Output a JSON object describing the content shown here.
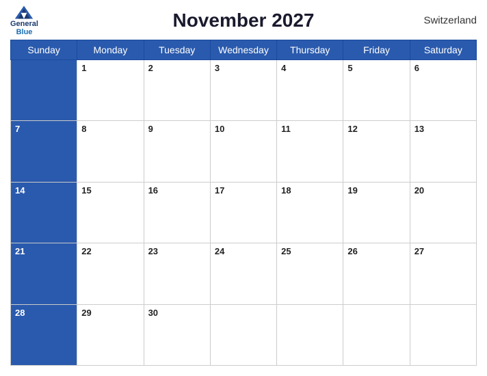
{
  "header": {
    "title": "November 2027",
    "country": "Switzerland",
    "logo": {
      "general": "General",
      "blue": "Blue"
    }
  },
  "weekdays": [
    "Sunday",
    "Monday",
    "Tuesday",
    "Wednesday",
    "Thursday",
    "Friday",
    "Saturday"
  ],
  "weeks": [
    [
      {
        "day": "",
        "bg": "blue"
      },
      {
        "day": "1",
        "bg": "white"
      },
      {
        "day": "2",
        "bg": "white"
      },
      {
        "day": "3",
        "bg": "white"
      },
      {
        "day": "4",
        "bg": "white"
      },
      {
        "day": "5",
        "bg": "white"
      },
      {
        "day": "6",
        "bg": "white"
      }
    ],
    [
      {
        "day": "7",
        "bg": "blue"
      },
      {
        "day": "8",
        "bg": "white"
      },
      {
        "day": "9",
        "bg": "white"
      },
      {
        "day": "10",
        "bg": "white"
      },
      {
        "day": "11",
        "bg": "white"
      },
      {
        "day": "12",
        "bg": "white"
      },
      {
        "day": "13",
        "bg": "white"
      }
    ],
    [
      {
        "day": "14",
        "bg": "blue"
      },
      {
        "day": "15",
        "bg": "white"
      },
      {
        "day": "16",
        "bg": "white"
      },
      {
        "day": "17",
        "bg": "white"
      },
      {
        "day": "18",
        "bg": "white"
      },
      {
        "day": "19",
        "bg": "white"
      },
      {
        "day": "20",
        "bg": "white"
      }
    ],
    [
      {
        "day": "21",
        "bg": "blue"
      },
      {
        "day": "22",
        "bg": "white"
      },
      {
        "day": "23",
        "bg": "white"
      },
      {
        "day": "24",
        "bg": "white"
      },
      {
        "day": "25",
        "bg": "white"
      },
      {
        "day": "26",
        "bg": "white"
      },
      {
        "day": "27",
        "bg": "white"
      }
    ],
    [
      {
        "day": "28",
        "bg": "blue"
      },
      {
        "day": "29",
        "bg": "white"
      },
      {
        "day": "30",
        "bg": "white"
      },
      {
        "day": "",
        "bg": "white"
      },
      {
        "day": "",
        "bg": "white"
      },
      {
        "day": "",
        "bg": "white"
      },
      {
        "day": "",
        "bg": "white"
      }
    ]
  ]
}
